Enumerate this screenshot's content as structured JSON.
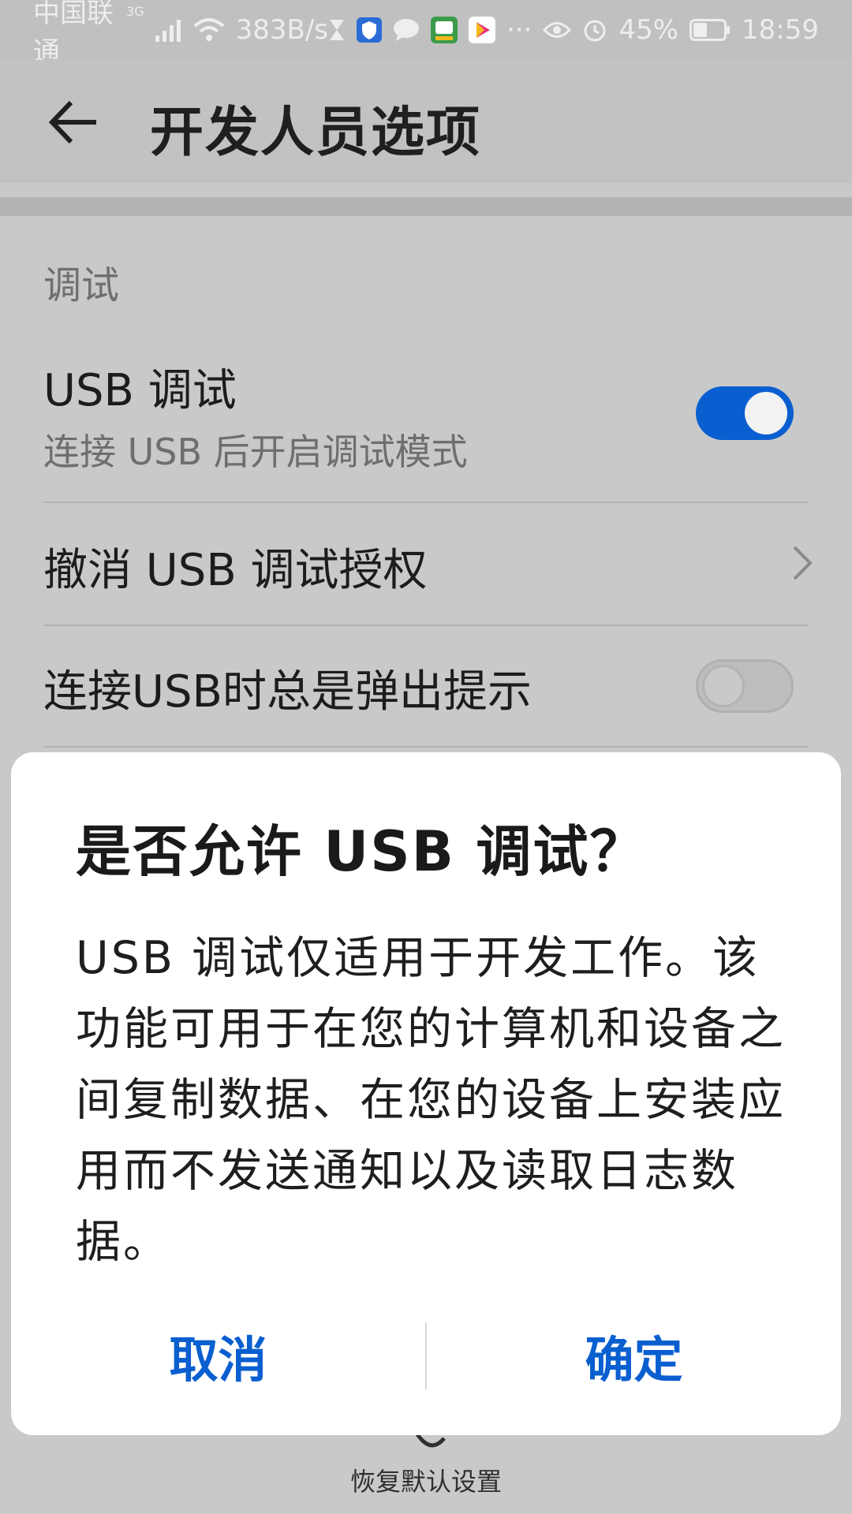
{
  "status_bar": {
    "carrier": "中国联通",
    "network_type": "3G",
    "speed": "383B/s",
    "battery": "45%",
    "time": "18:59"
  },
  "header": {
    "title": "开发人员选项"
  },
  "section": {
    "header": "调试"
  },
  "settings": {
    "usb_debugging": {
      "title": "USB 调试",
      "subtitle": "连接 USB 后开启调试模式",
      "enabled": true
    },
    "revoke_auth": {
      "title": "撤消 USB 调试授权"
    },
    "usb_prompt": {
      "title": "连接USB时总是弹出提示",
      "enabled": false
    }
  },
  "footer": {
    "restore_label": "恢复默认设置"
  },
  "dialog": {
    "title": "是否允许 USB 调试？",
    "body": "USB 调试仅适用于开发工作。该功能可用于在您的计算机和设备之间复制数据、在您的设备上安装应用而不发送通知以及读取日志数据。",
    "cancel_label": "取消",
    "confirm_label": "确定"
  },
  "colors": {
    "accent": "#0a5fd0",
    "scrim_background": "#c9c9c9",
    "dialog_background": "#ffffff"
  }
}
